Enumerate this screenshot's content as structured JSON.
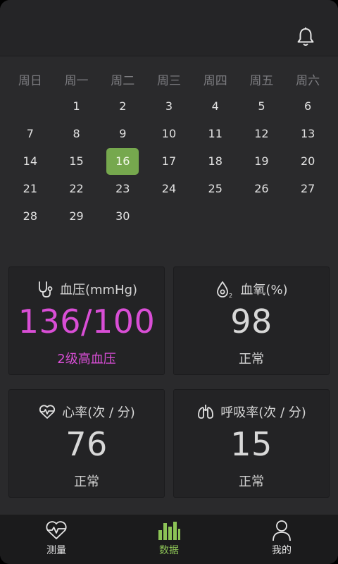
{
  "calendar": {
    "weekdays": [
      "周日",
      "周一",
      "周二",
      "周三",
      "周四",
      "周五",
      "周六"
    ],
    "days": [
      "",
      "1",
      "2",
      "3",
      "4",
      "5",
      "6",
      "7",
      "8",
      "9",
      "10",
      "11",
      "12",
      "13",
      "14",
      "15",
      "16",
      "17",
      "18",
      "19",
      "20",
      "21",
      "22",
      "23",
      "24",
      "25",
      "26",
      "27",
      "28",
      "29",
      "30",
      "",
      "",
      "",
      ""
    ],
    "selected_day": "16"
  },
  "cards": {
    "bp": {
      "title": "血压(mmHg)",
      "value": "136/100",
      "status": "2级高血压",
      "icon": "stethoscope-icon",
      "accent": "#d94ed6"
    },
    "spo2": {
      "title": "血氧(%)",
      "value": "98",
      "status": "正常",
      "icon": "oxygen-drop-icon"
    },
    "hr": {
      "title": "心率(次 / 分)",
      "value": "76",
      "status": "正常",
      "icon": "heartbeat-icon"
    },
    "rr": {
      "title": "呼吸率(次 / 分)",
      "value": "15",
      "status": "正常",
      "icon": "lungs-icon"
    }
  },
  "tabs": [
    {
      "label": "测量",
      "icon": "heart-pulse-icon",
      "active": false
    },
    {
      "label": "数据",
      "icon": "bar-chart-icon",
      "active": true
    },
    {
      "label": "我的",
      "icon": "user-icon",
      "active": false
    }
  ],
  "header": {
    "icon": "bell-icon"
  },
  "colors": {
    "selected_day": "#76a84e",
    "active_tab": "#8cc356",
    "alert": "#d94ed6"
  }
}
